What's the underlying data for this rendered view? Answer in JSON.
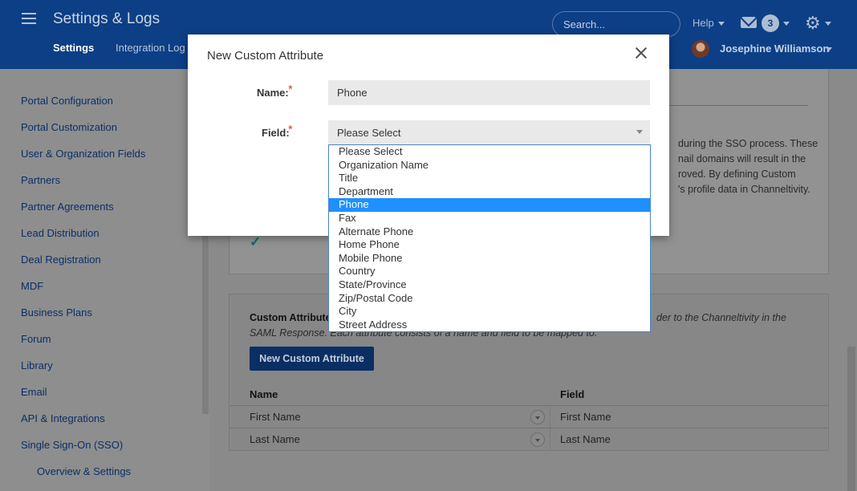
{
  "header": {
    "app_title": "Settings & Logs",
    "tabs": [
      {
        "label": "Settings"
      },
      {
        "label": "Integration Log"
      }
    ],
    "search_placeholder": "Search...",
    "help_label": "Help",
    "notification_count": "3",
    "user_name": "Josephine Williamson"
  },
  "sidebar": {
    "items": [
      {
        "label": "Portal Configuration"
      },
      {
        "label": "Portal Customization"
      },
      {
        "label": "User & Organization Fields"
      },
      {
        "label": "Partners"
      },
      {
        "label": "Partner Agreements"
      },
      {
        "label": "Lead Distribution"
      },
      {
        "label": "Deal Registration"
      },
      {
        "label": "MDF"
      },
      {
        "label": "Business Plans"
      },
      {
        "label": "Forum"
      },
      {
        "label": "Library"
      },
      {
        "label": "Email"
      },
      {
        "label": "API & Integrations"
      },
      {
        "label": "Single Sign-On (SSO)"
      },
      {
        "label": "Overview & Settings"
      }
    ]
  },
  "background": {
    "para_lines": [
      "during the SSO process. These",
      "nail domains will result in the",
      "roved. By defining Custom",
      "'s profile data in Channeltivity."
    ],
    "custom_attributes_title": "Custom Attribute",
    "custom_attributes_desc_right": "der to the Channeltivity in the",
    "custom_attributes_desc_line2": "SAML Response. Each attribute consists of a name and field to be mapped to.",
    "new_button_label": "New Custom Attribute",
    "table": {
      "headers": {
        "name": "Name",
        "field": "Field"
      },
      "rows": [
        {
          "name": "First Name",
          "field": "First Name"
        },
        {
          "name": "Last Name",
          "field": "Last Name"
        }
      ]
    }
  },
  "modal": {
    "title": "New Custom Attribute",
    "name_label": "Name:",
    "name_value": "Phone",
    "field_label": "Field:",
    "field_selected": "Please Select",
    "required_mark": "*",
    "options": [
      "Please Select",
      "Organization Name",
      "Title",
      "Department",
      "Phone",
      "Fax",
      "Alternate Phone",
      "Home Phone",
      "Mobile Phone",
      "Country",
      "State/Province",
      "Zip/Postal Code",
      "City",
      "Street Address"
    ],
    "highlighted_option": "Phone"
  },
  "colors": {
    "header_bg": "#0c3f86",
    "highlight": "#1e90ff",
    "required": "#e03a2f"
  }
}
